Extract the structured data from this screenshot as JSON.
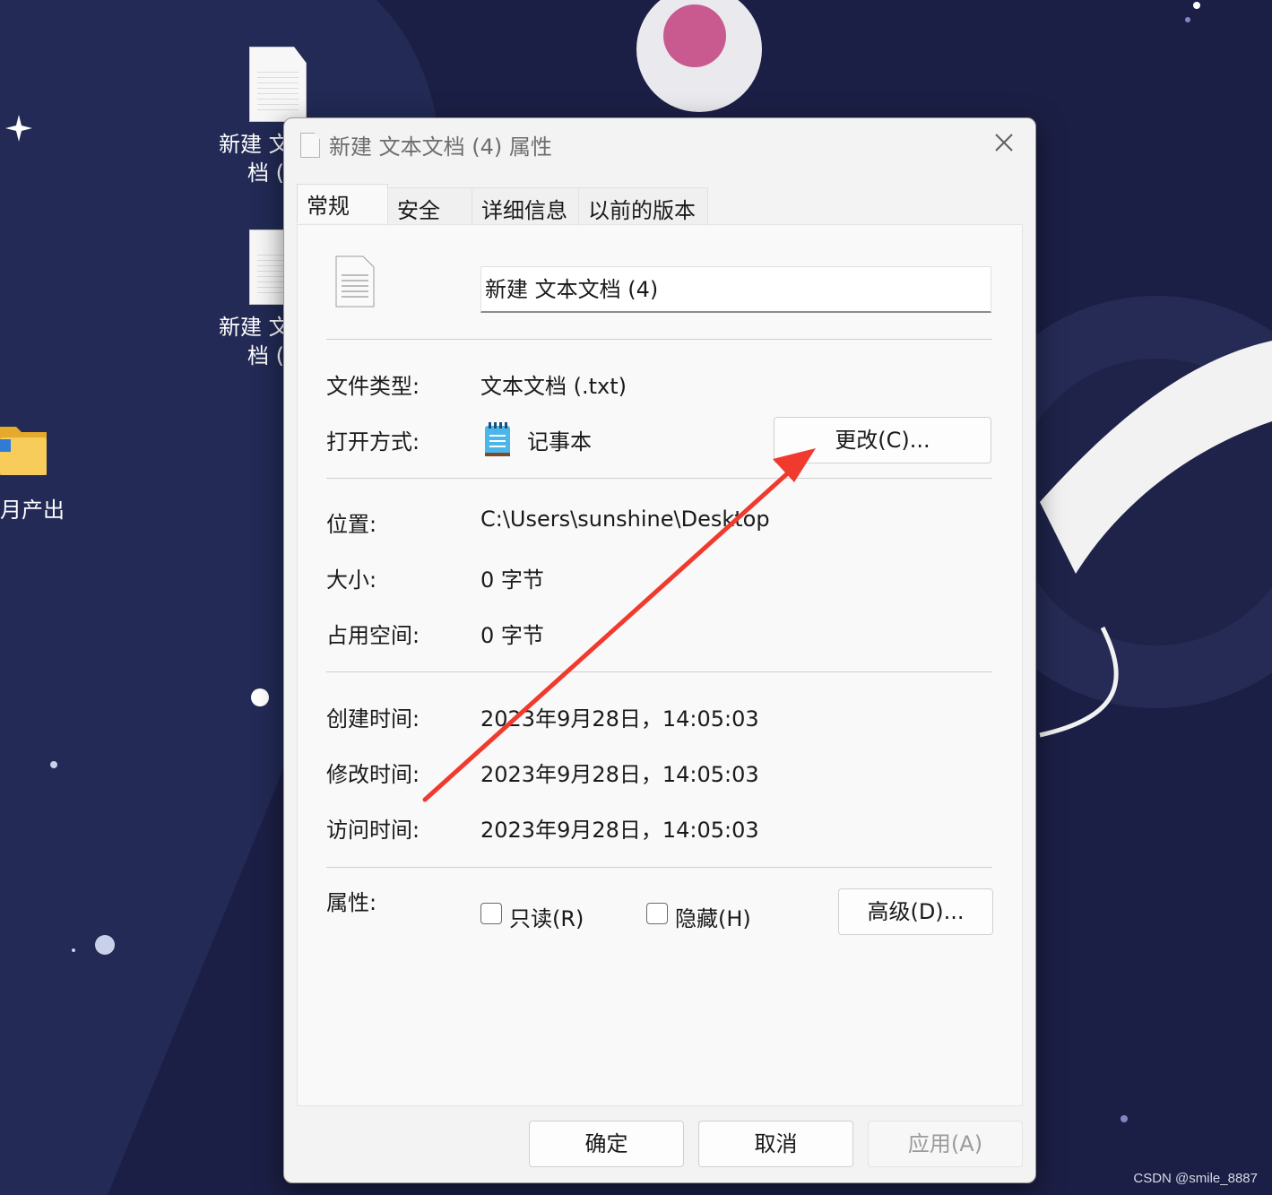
{
  "desktop": {
    "icons": [
      {
        "label_line1": "新建 文",
        "label_line2": "档 ("
      },
      {
        "label_line1": "新建 文",
        "label_line2": "档 ("
      },
      {
        "label_line1": "月产出"
      }
    ],
    "watermark": "CSDN @smile_8887"
  },
  "dialog": {
    "title": "新建 文本文档 (4) 属性",
    "tabs": [
      {
        "label": "常规",
        "active": true
      },
      {
        "label": "安全"
      },
      {
        "label": "详细信息"
      },
      {
        "label": "以前的版本"
      }
    ],
    "file_name": "新建 文本文档 (4)",
    "file_type_label": "文件类型:",
    "file_type_value": "文本文档 (.txt)",
    "open_with_label": "打开方式:",
    "open_with_value": "记事本",
    "change_button": "更改(C)...",
    "location_label": "位置:",
    "location_value": "C:\\Users\\sunshine\\Desktop",
    "size_label": "大小:",
    "size_value": "0 字节",
    "size_on_disk_label": "占用空间:",
    "size_on_disk_value": "0 字节",
    "created_label": "创建时间:",
    "created_value": "2023年9月28日，14:05:03",
    "modified_label": "修改时间:",
    "modified_value": "2023年9月28日，14:05:03",
    "accessed_label": "访问时间:",
    "accessed_value": "2023年9月28日，14:05:03",
    "attributes_label": "属性:",
    "readonly_label": "只读(R)",
    "hidden_label": "隐藏(H)",
    "advanced_button": "高级(D)...",
    "ok_button": "确定",
    "cancel_button": "取消",
    "apply_button": "应用(A)"
  },
  "colors": {
    "wallpaper": "#1c1f45",
    "annotation_arrow": "#f03a2e"
  }
}
